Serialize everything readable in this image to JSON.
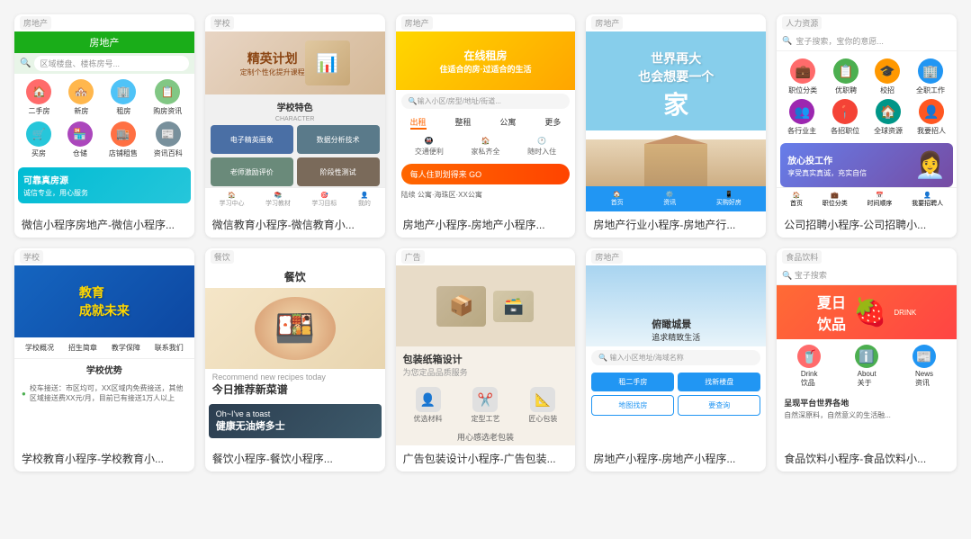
{
  "cards": [
    {
      "id": "card1",
      "tag": "房地产",
      "label": "微信小程序房地产-微信小程序...",
      "type": "real-estate-1"
    },
    {
      "id": "card2",
      "tag": "学校",
      "label": "微信教育小程序-微信教育小...",
      "type": "school-1"
    },
    {
      "id": "card3",
      "tag": "房地产",
      "label": "房地产小程序-房地产小程序...",
      "type": "real-estate-2"
    },
    {
      "id": "card4",
      "tag": "房地产",
      "label": "房地产行业小程序-房地产行...",
      "type": "real-estate-3"
    },
    {
      "id": "card5",
      "tag": "人力资源",
      "label": "公司招聘小程序-公司招聘小...",
      "type": "hr-1"
    },
    {
      "id": "card6",
      "tag": "学校",
      "label": "学校教育小程序-学校教育小...",
      "type": "school-2"
    },
    {
      "id": "card7",
      "tag": "餐饮",
      "label": "餐饮小程序-餐饮小程序...",
      "type": "food-1"
    },
    {
      "id": "card8",
      "tag": "广告",
      "label": "广告包装设计小程序-广告包装...",
      "type": "ad-1"
    },
    {
      "id": "card9",
      "tag": "房地产",
      "label": "房地产小程序-房地产小程序...",
      "type": "real-estate-4"
    },
    {
      "id": "card10",
      "tag": "食品饮料",
      "label": "食品饮料小程序-食品饮料小...",
      "type": "food-drink-1"
    }
  ],
  "icons": {
    "search": "🔍",
    "home": "🏠",
    "store": "🏪",
    "city": "🏙️",
    "map": "📍",
    "book": "📚",
    "user": "👤",
    "star": "⭐",
    "chart": "📊",
    "people": "👥",
    "building": "🏢",
    "money": "💰",
    "phone": "📱",
    "food": "🍱",
    "drink": "🥤",
    "fruit": "🍓"
  }
}
